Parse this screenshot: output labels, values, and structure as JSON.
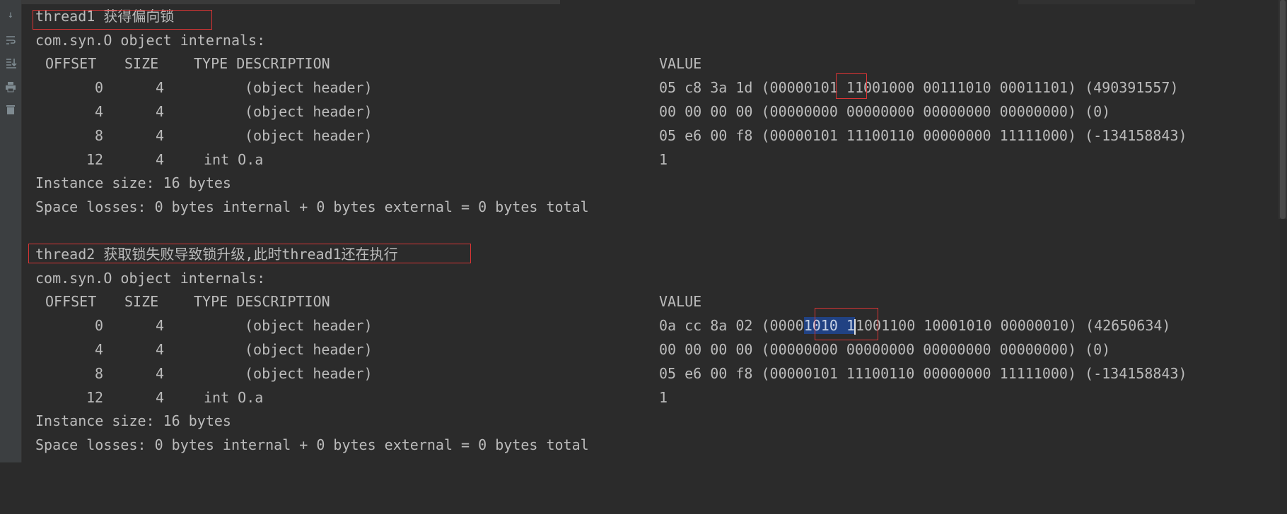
{
  "block1": {
    "title": "thread1 获得偏向锁",
    "object_line": "com.syn.O object internals:",
    "header": {
      "offset": "OFFSET",
      "size": "SIZE",
      "type_desc": "TYPE DESCRIPTION",
      "value": "VALUE"
    },
    "rows": [
      {
        "offset": "0",
        "size": "4",
        "desc": "(object header)",
        "value_a": "05 c8 3a 1d (00000",
        "value_b": "101",
        "value_c": " 11001000 00111010 00011101) (490391557)"
      },
      {
        "offset": "4",
        "size": "4",
        "desc": "(object header)",
        "value": "00 00 00 00 (00000000 00000000 00000000 00000000) (0)"
      },
      {
        "offset": "8",
        "size": "4",
        "desc": "(object header)",
        "value": "05 e6 00 f8 (00000101 11100110 00000000 11111000) (-134158843)"
      },
      {
        "offset": "12",
        "size": "4",
        "desc": "int O.a",
        "value": "1"
      }
    ],
    "instance_size": "Instance size: 16 bytes",
    "space_losses": "Space losses: 0 bytes internal + 0 bytes external = 0 bytes total"
  },
  "block2": {
    "title": "thread2 获取锁失败导致锁升级,此时thread1还在执行",
    "object_line": "com.syn.O object internals:",
    "header": {
      "offset": "OFFSET",
      "size": "SIZE",
      "type_desc": "TYPE DESCRIPTION",
      "value": "VALUE"
    },
    "rows": [
      {
        "offset": "0",
        "size": "4",
        "desc": "(object header)",
        "value_a": "0a cc 8a 02 (0000",
        "value_b": "1010 1",
        "value_c": "1001100 10001010 00000010) (42650634)"
      },
      {
        "offset": "4",
        "size": "4",
        "desc": "(object header)",
        "value": "00 00 00 00 (00000000 00000000 00000000 00000000) (0)"
      },
      {
        "offset": "8",
        "size": "4",
        "desc": "(object header)",
        "value": "05 e6 00 f8 (00000101 11100110 00000000 11111000) (-134158843)"
      },
      {
        "offset": "12",
        "size": "4",
        "desc": "int O.a",
        "value": "1"
      }
    ],
    "instance_size": "Instance size: 16 bytes",
    "space_losses": "Space losses: 0 bytes internal + 0 bytes external = 0 bytes total"
  },
  "gutter_icons": [
    "arrow-down-icon",
    "soft-wrap-icon",
    "scroll-to-end-icon",
    "print-icon",
    "trash-icon"
  ],
  "colors": {
    "background": "#2b2b2b",
    "text": "#bbbbbb",
    "selection": "#214283",
    "annotation_box": "#d83434"
  }
}
